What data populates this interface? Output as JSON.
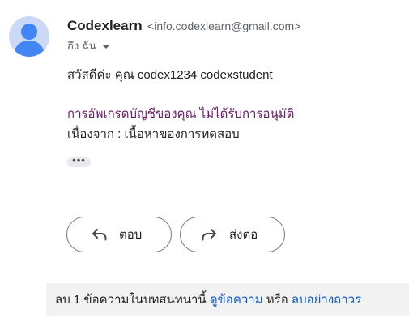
{
  "sender": {
    "name": "Codexlearn",
    "email": "<info.codexlearn@gmail.com>"
  },
  "recipient_label": "ถึง ฉัน",
  "message": {
    "greeting": "สวัสดีค่ะ คุณ codex1234 codexstudent",
    "status": "การอัพเกรดบัญชีของคุณ ไม่ได้รับการอนุมัติ",
    "reason": "เนื่องจาก  :  เนื้อหาของการทดสอบ"
  },
  "ellipsis_label": "•••",
  "actions": {
    "reply_label": "ตอบ",
    "forward_label": "ส่งต่อ"
  },
  "notice": {
    "text": "ลบ 1 ข้อความในบทสนทนานี้",
    "view_link": "ดูข้อความ",
    "or_text": "หรือ",
    "delete_link": "ลบอย่างถาวร"
  },
  "colors": {
    "avatar_bg": "#cbd9f7",
    "avatar_fg": "#4285f4",
    "status_text": "#6a1b6a",
    "link": "#0b57d0"
  },
  "icons": {
    "avatar": "person-icon",
    "caret": "caret-down-icon",
    "reply": "reply-arrow-icon",
    "forward": "forward-arrow-icon"
  }
}
